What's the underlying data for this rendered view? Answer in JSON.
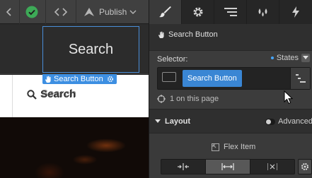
{
  "toolbar": {
    "publish_label": "Publish",
    "status_color": "#3daa57"
  },
  "canvas": {
    "nav_search_text": "Search",
    "selection_tag_label": "Search Button",
    "search_button_text": "Search",
    "search_button_ghost_text": "Search"
  },
  "panel": {
    "tabs": [
      {
        "icon": "brush-icon",
        "active": true
      },
      {
        "icon": "gear-icon",
        "active": false
      },
      {
        "icon": "navigator-icon",
        "active": false
      },
      {
        "icon": "drops-icon",
        "active": false
      },
      {
        "icon": "lightning-icon",
        "active": false
      }
    ],
    "element_title": "Search Button",
    "selector_label": "Selector:",
    "states_label": "States",
    "selector_class": "Search Button",
    "on_page_text": "1 on this page",
    "layout_label": "Layout",
    "advanced_label": "Advanced",
    "flex_item_label": "Flex Item",
    "accent_color": "#3a86d4"
  }
}
